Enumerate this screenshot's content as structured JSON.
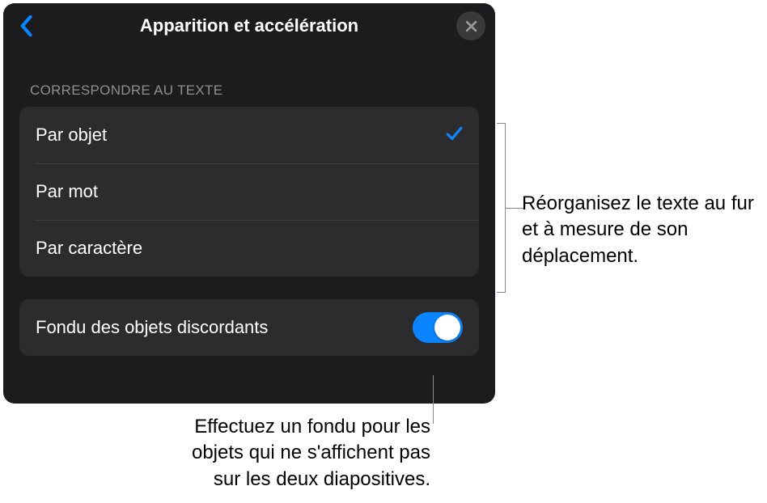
{
  "header": {
    "title": "Apparition et accélération"
  },
  "section": {
    "header": "CORRESPONDRE AU TEXTE"
  },
  "options": [
    {
      "label": "Par objet",
      "selected": true
    },
    {
      "label": "Par mot",
      "selected": false
    },
    {
      "label": "Par caractère",
      "selected": false
    }
  ],
  "toggle": {
    "label": "Fondu des objets discordants",
    "on": true
  },
  "callouts": {
    "right": "Réorganisez le texte au fur et à mesure de son déplacement.",
    "bottom": "Effectuez un fondu pour les objets qui ne s'affichent pas sur les deux diapositives."
  }
}
